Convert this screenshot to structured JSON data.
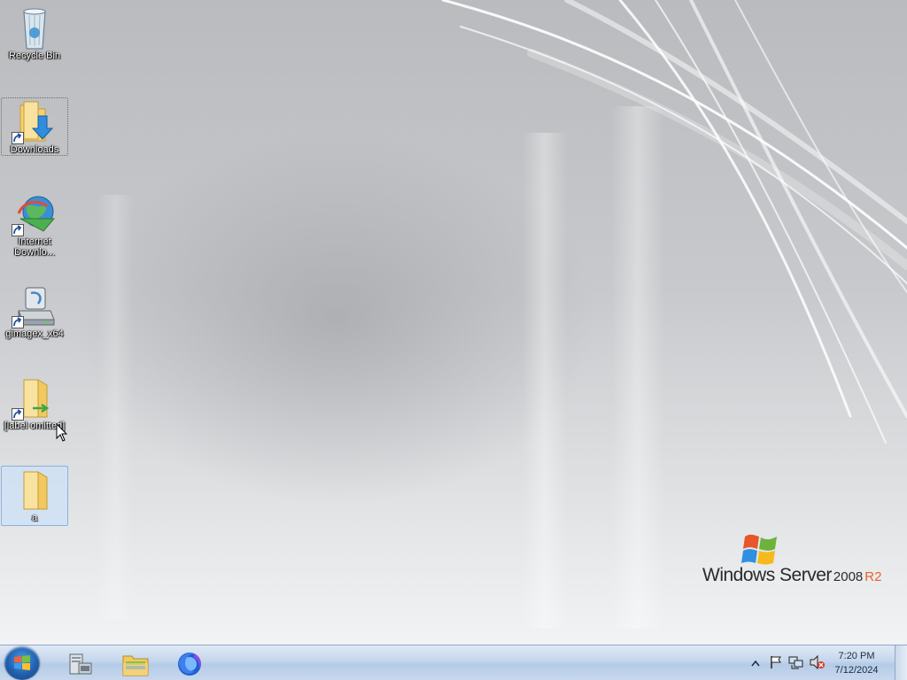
{
  "desktop": {
    "icons": [
      {
        "label": "Recycle Bin",
        "icon": "recycle-bin-icon"
      },
      {
        "label": "Downloads",
        "icon": "downloads-folder-icon",
        "shortcut": true
      },
      {
        "label": "Internet Downlo...",
        "icon": "internet-download-manager-icon",
        "shortcut": true
      },
      {
        "label": "gimagex_x64",
        "icon": "gimagex-icon",
        "shortcut": true
      },
      {
        "label": "[label omitted]",
        "icon": "folder-icon",
        "shortcut": true
      },
      {
        "label": "a",
        "icon": "folder-icon",
        "state": "selected"
      }
    ]
  },
  "branding": {
    "windows": "Windows Server",
    "year": "2008",
    "release": "R2"
  },
  "taskbar": {
    "pinned": [
      {
        "name": "Server Manager",
        "icon": "server-manager-icon"
      },
      {
        "name": "Windows Explorer",
        "icon": "folder-icon"
      },
      {
        "name": "Firefox",
        "icon": "firefox-icon"
      }
    ],
    "tray": {
      "icons": [
        "show-hidden-icons-icon",
        "action-center-flag-icon",
        "network-icon",
        "volume-muted-icon"
      ],
      "time": "7:20 PM",
      "date": "7/12/2024"
    }
  },
  "colors": {
    "taskbar": "#c4d6ec",
    "selection": "#cde1f7",
    "brand_accent": "#e8632a"
  }
}
